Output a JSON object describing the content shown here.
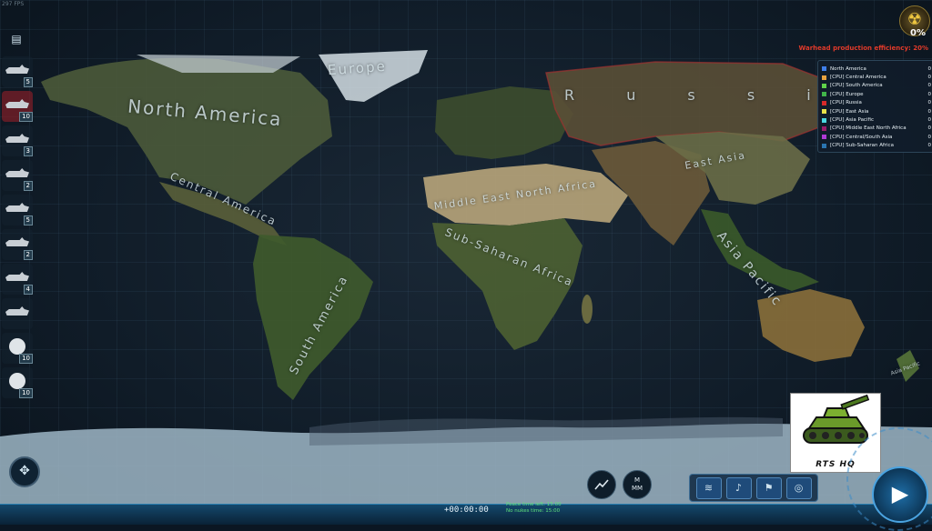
{
  "top_left_text": "297 FPS",
  "menu_icon": "document-icon",
  "map_labels": {
    "north_america": "North America",
    "europe": "Europe",
    "russia": "R u s s i",
    "east_asia": "East Asia",
    "central_america": "Central America",
    "middle_east_north_africa": "Middle East North Africa",
    "sub_saharan_africa": "Sub-Saharan Africa",
    "south_america": "South America",
    "asia_pacific": "Asia Pacific",
    "asia_pacific_small": "Asia Pacific"
  },
  "units": [
    {
      "icon": "armored-vehicle-icon",
      "count": "5",
      "active": false
    },
    {
      "icon": "bomber-aircraft-icon",
      "count": "10",
      "active": true
    },
    {
      "icon": "destroyer-ship-icon",
      "count": "3",
      "active": false
    },
    {
      "icon": "cruiser-ship-icon",
      "count": "2",
      "active": false
    },
    {
      "icon": "frigate-ship-icon",
      "count": "5",
      "active": false
    },
    {
      "icon": "corvette-ship-icon",
      "count": "2",
      "active": false
    },
    {
      "icon": "submarine-icon",
      "count": "4",
      "active": false
    },
    {
      "icon": "carrier-ship-icon",
      "count": "",
      "active": false
    },
    {
      "icon": "radar-dish-icon",
      "count": "10",
      "active": false
    },
    {
      "icon": "missile-launcher-icon",
      "count": "10",
      "active": false
    }
  ],
  "nuke": {
    "icon": "radiation-icon",
    "percent": "0%"
  },
  "efficiency_text": "Warhead production efficiency: 20%",
  "legend": [
    {
      "name": "North America",
      "score": "0",
      "color": "#3f7ee8"
    },
    {
      "name": "[CPU] Central America",
      "score": "0",
      "color": "#e8a23f"
    },
    {
      "name": "[CPU] South America",
      "score": "0",
      "color": "#5fd14a"
    },
    {
      "name": "[CPU] Europe",
      "score": "0",
      "color": "#41b54a"
    },
    {
      "name": "[CPU] Russia",
      "score": "0",
      "color": "#d62a2a"
    },
    {
      "name": "[CPU] East Asia",
      "score": "0",
      "color": "#e8e14a"
    },
    {
      "name": "[CPU] Asia Pacific",
      "score": "0",
      "color": "#4ad8e0"
    },
    {
      "name": "[CPU] Middle East North Africa",
      "score": "0",
      "color": "#9a1c6a"
    },
    {
      "name": "[CPU] Central/South Asia",
      "score": "0",
      "color": "#b03ad6"
    },
    {
      "name": "[CPU] Sub-Saharan Africa",
      "score": "0",
      "color": "#2a74b0"
    }
  ],
  "logo_text": "RTS HQ",
  "clock": "+00:00:00",
  "peace_time": "Peace time left: 15:00",
  "nuke_time": "No nukes time: 15:00",
  "buttons": {
    "graph": "chart-line-icon",
    "mm": "M\nMM"
  },
  "tools": [
    "wave-icon",
    "chart-icon",
    "flag-icon",
    "globe-icon"
  ],
  "tool_glyphs": [
    "≋",
    "♪",
    "⚑",
    "◎"
  ],
  "play_icon": "play-icon",
  "play_glyph": "▶",
  "compass_glyph": "✥"
}
